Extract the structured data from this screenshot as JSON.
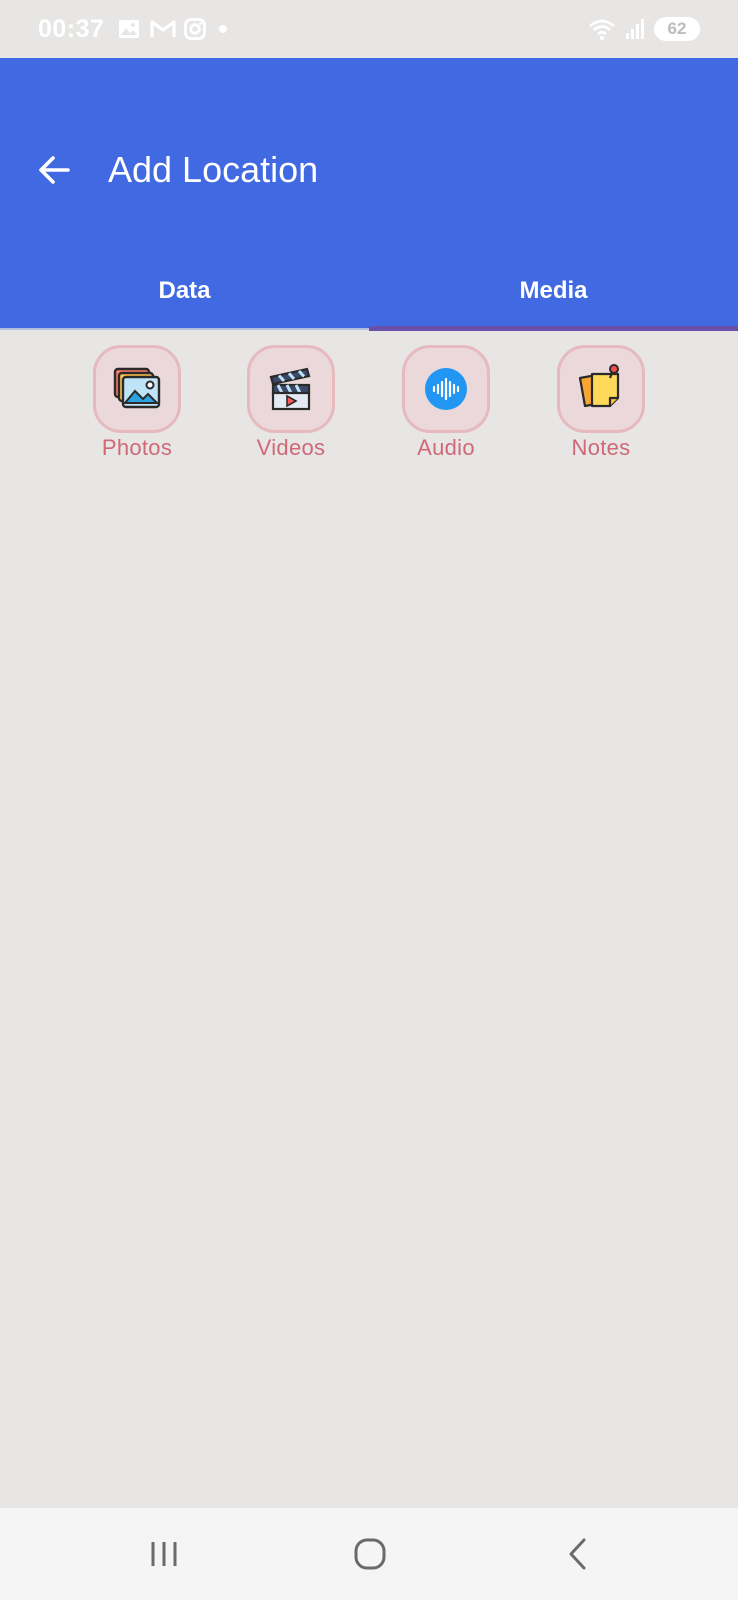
{
  "status_bar": {
    "time": "00:37",
    "battery": "62",
    "icons": [
      "gallery-icon",
      "gmail-icon",
      "instagram-icon",
      "dot-icon",
      "wifi-icon",
      "signal-icon"
    ]
  },
  "app_bar": {
    "title": "Add Location",
    "back_icon": "arrow-back-icon",
    "color": "#4169e1"
  },
  "tabs": [
    {
      "label": "Data",
      "selected": false
    },
    {
      "label": "Media",
      "selected": true
    }
  ],
  "media_items": [
    {
      "label": "Photos",
      "icon": "photos-icon"
    },
    {
      "label": "Videos",
      "icon": "clapperboard-icon"
    },
    {
      "label": "Audio",
      "icon": "audio-wave-icon"
    },
    {
      "label": "Notes",
      "icon": "sticky-notes-icon"
    }
  ],
  "colors": {
    "accent": "#4169e1",
    "tab_indicator": "#6a4fa8",
    "media_label": "#d06876",
    "media_tile": "#ead8da"
  },
  "nav_bar": {
    "icons": [
      "recent-apps-icon",
      "home-icon",
      "back-icon"
    ]
  }
}
